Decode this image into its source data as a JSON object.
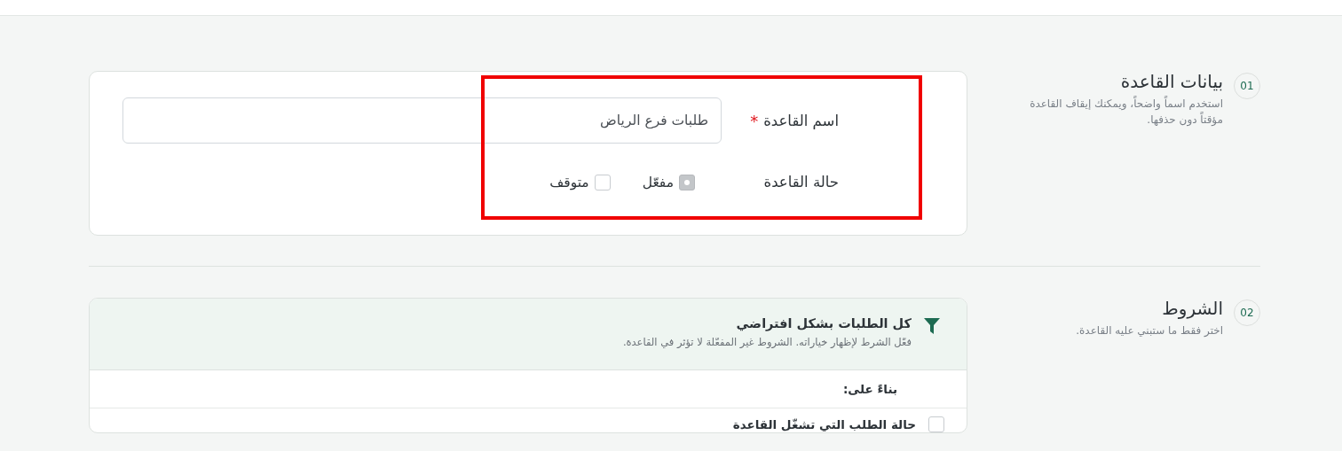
{
  "sections": [
    {
      "step": "01",
      "title": "بيانات القاعدة",
      "description": "استخدم اسماً واضحاً، ويمكنك إيقاف القاعدة مؤقتاً دون حذفها.",
      "kind": "details",
      "name_field": {
        "label": "اسم القاعدة",
        "required_mark": "*",
        "value": "طلبات فرع الرياض"
      },
      "status_field": {
        "label": "حالة القاعدة",
        "options": [
          {
            "label": "مفعّل",
            "selected": true
          },
          {
            "label": "متوقف",
            "selected": false
          }
        ]
      }
    },
    {
      "step": "02",
      "title": "الشروط",
      "description": "اختر فقط ما ستبني عليه القاعدة.",
      "kind": "conditions",
      "header": {
        "title": "كل الطلبات بشكل افتراضي",
        "subtitle": "فعّل الشرط لإظهار خياراته. الشروط غير المفعّلة لا تؤثر في القاعدة."
      },
      "based_on": "بناءً على:",
      "conditions": [
        {
          "label": "حالة الطلب التي تشغّل القاعدة",
          "checked": false
        }
      ]
    }
  ]
}
